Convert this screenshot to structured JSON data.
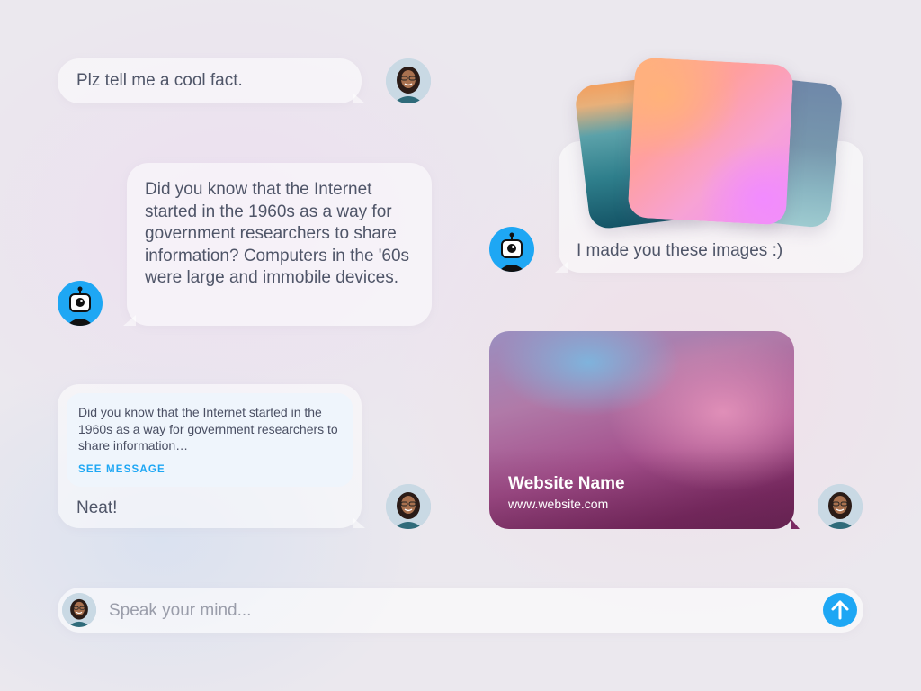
{
  "messages": {
    "m1": {
      "sender": "user",
      "text": "Plz tell me a cool fact."
    },
    "m2": {
      "sender": "bot",
      "text": "Did you know that the Internet started in the 1960s as a way for government researchers to share information? Computers in the '60s were large and immobile devices."
    },
    "m3": {
      "sender": "user",
      "quote": "Did you know that the Internet started in the 1960s as a way for government researchers to share information…",
      "quote_action": "SEE MESSAGE",
      "text": "Neat!"
    },
    "m4": {
      "sender": "bot",
      "text": "I made you these images :)"
    },
    "m5": {
      "sender": "user",
      "link_title": "Website Name",
      "link_url": "www.website.com"
    }
  },
  "composer": {
    "placeholder": "Speak your mind..."
  },
  "colors": {
    "accent": "#1ea7f4",
    "text": "#4f5568",
    "quote_bg": "#eef4fc"
  },
  "icons": {
    "bot": "robot-icon",
    "send": "arrow-up-icon"
  }
}
